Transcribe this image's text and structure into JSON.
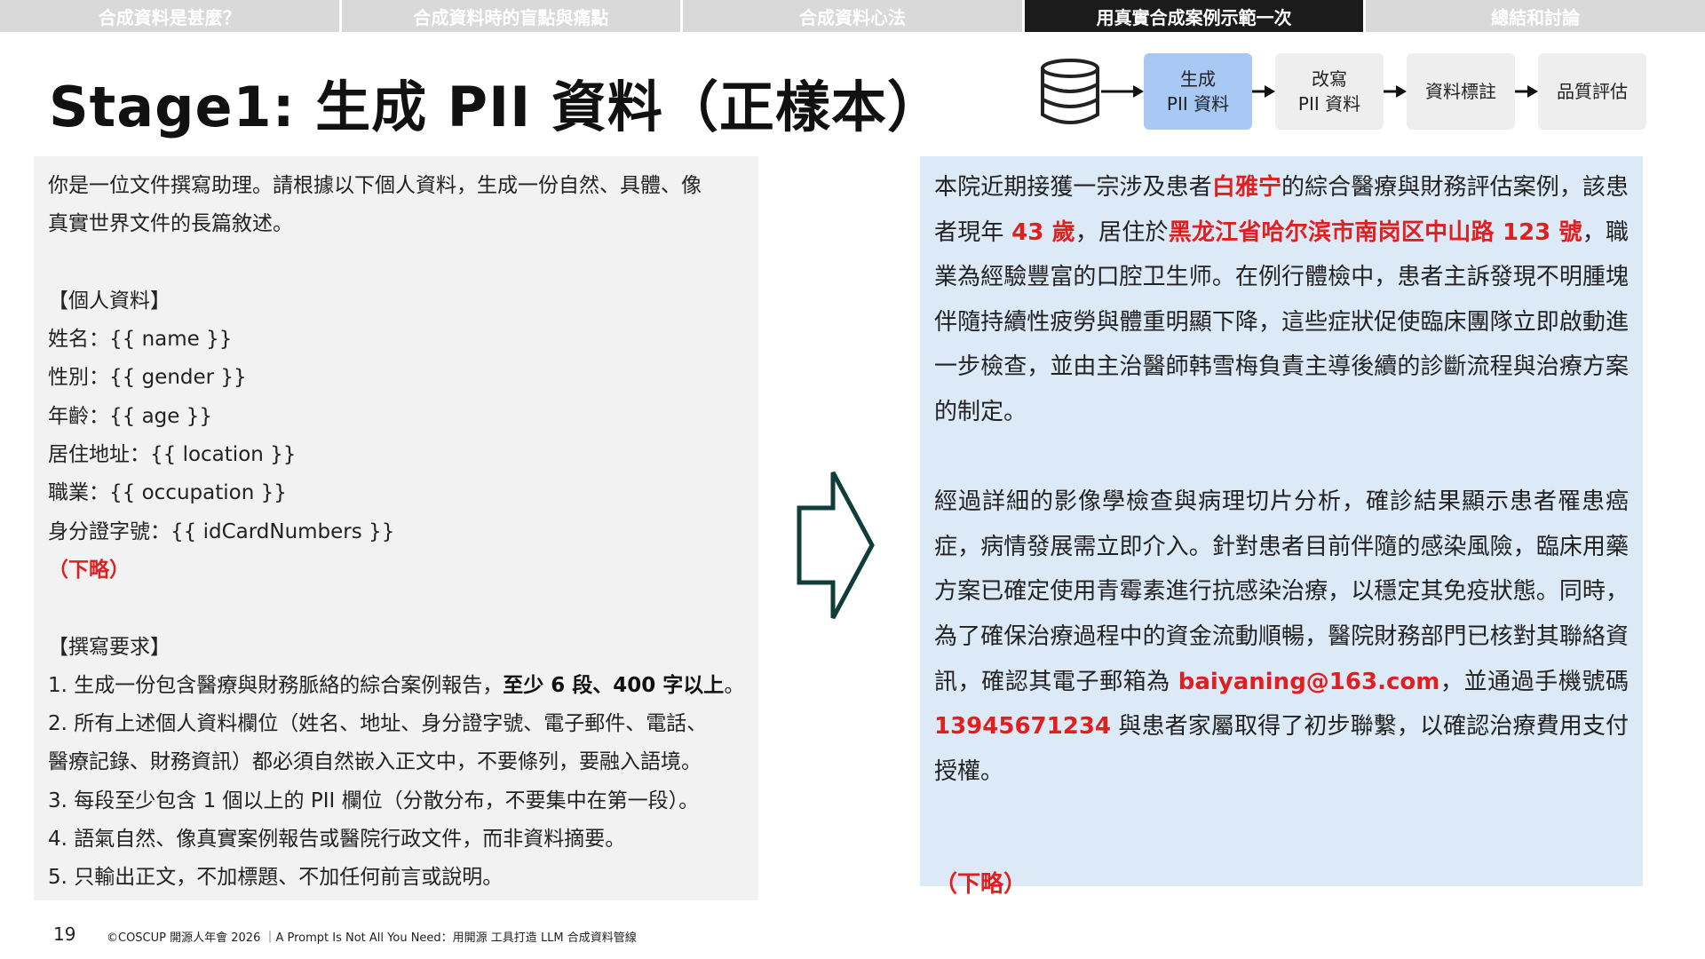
{
  "nav": {
    "tabs": [
      {
        "label": "合成資料是甚麼？",
        "active": false
      },
      {
        "label": "合成資料時的盲點與痛點",
        "active": false
      },
      {
        "label": "合成資料心法",
        "active": false
      },
      {
        "label": "用真實合成案例示範一次",
        "active": true
      },
      {
        "label": "總結和討論",
        "active": false
      }
    ]
  },
  "title": "Stage1: 生成 PII 資料（正樣本）",
  "pipeline": {
    "icon": "database-icon",
    "steps": [
      {
        "line1": "生成",
        "line2": "PII 資料",
        "active": true
      },
      {
        "line1": "改寫",
        "line2": "PII 資料",
        "active": false
      },
      {
        "line1": "資料標註",
        "line2": "",
        "active": false
      },
      {
        "line1": "品質評估",
        "line2": "",
        "active": false
      }
    ]
  },
  "prompt": {
    "intro_1": "你是一位文件撰寫助理。請根據以下個人資料，生成一份自然、具體、像",
    "intro_2": "真實世界文件的長篇敘述。",
    "personal_header": "【個人資料】",
    "fields": [
      "姓名：{{ name }}",
      "性別：{{ gender }}",
      "年齡：{{ age }}",
      "居住地址：{{ location }}",
      "職業：{{ occupation }}",
      "身分證字號：{{ idCardNumbers }}"
    ],
    "omitted": "（下略）",
    "requirements_header": "【撰寫要求】",
    "req1_a": "1. 生成一份包含醫療與財務脈絡的綜合案例報告，",
    "req1_b": "至少 6 段、400 字以上",
    "req1_c": "。",
    "req2_a": "2. 所有上述個人資料欄位（姓名、地址、身分證字號、電子郵件、電話、",
    "req2_b": "醫療記錄、財務資訊）都必須自然嵌入正文中，不要條列，要融入語境。",
    "req3": "3. 每段至少包含 1 個以上的 PII 欄位（分散分布，不要集中在第一段）。",
    "req4": "4. 語氣自然、像真實案例報告或醫院行政文件，而非資料摘要。",
    "req5": "5. 只輸出正文，不加標題、不加任何前言或說明。"
  },
  "output": {
    "p1_t1": "本院近期接獲一宗涉及患者",
    "p1_name": "白雅宁",
    "p1_t2": "的綜合醫療與財務評估案例，該患者現年 ",
    "p1_age": "43 歲",
    "p1_t3": "，居住於",
    "p1_address": "黑龙江省哈尔滨市南岗区中山路 123 號",
    "p1_t4": "，職業為經驗豐富的口腔卫生师。在例行體檢中，患者主訴發現不明腫塊伴隨持續性疲勞與體重明顯下降，這些症狀促使臨床團隊立即啟動進一步檢查，並由主治醫師韩雪梅負責主導後續的診斷流程與治療方案的制定。",
    "p2_t1": "經過詳細的影像學檢查與病理切片分析，確診結果顯示患者罹患癌症，病情發展需立即介入。針對患者目前伴隨的感染風險，臨床用藥方案已確定使用青霉素進行抗感染治療，以穩定其免疫狀態。同時，為了確保治療過程中的資金流動順暢，醫院財務部門已核對其聯絡資訊，確認其電子郵箱為 ",
    "p2_email": "baiyaning@163.com",
    "p2_t2": "，並通過手機號碼 ",
    "p2_phone": "13945671234",
    "p2_t3": " 與患者家屬取得了初步聯繫，以確認治療費用支付授權。",
    "omitted": "（下略）"
  },
  "footer": {
    "page_number": "19",
    "text": "©COSCUP 開源人年會 2026 ｜A Prompt Is Not All You Need：用開源 工具打造 LLM 合成資料管線"
  }
}
